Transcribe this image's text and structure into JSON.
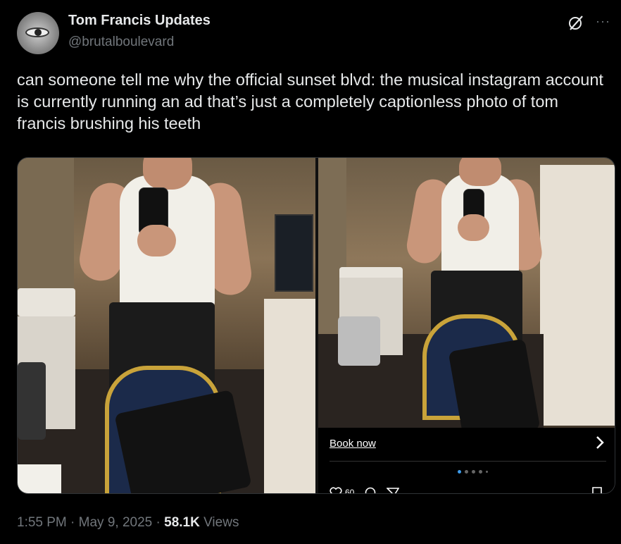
{
  "author": {
    "name": "Tom Francis Updates",
    "handle": "@brutalboulevard"
  },
  "tweet": {
    "text": "can someone tell me why the official sunset blvd: the musical instagram account is currently running an ad that’s just a completely captionless photo of tom francis brushing his teeth"
  },
  "ad": {
    "cta_label": "Book now",
    "like_count": "60"
  },
  "meta": {
    "time": "1:55 PM",
    "separator1": " · ",
    "date": "May 9, 2025",
    "separator2": " · ",
    "views_count": "58.1K",
    "views_label": " Views"
  },
  "icons": {
    "grok": "grok-icon",
    "more": "more-options-icon",
    "chevron": "chevron-right-icon",
    "heart": "heart-icon",
    "comment": "comment-icon",
    "send": "send-icon",
    "bookmark": "bookmark-icon"
  },
  "colors": {
    "background": "#000000",
    "text_primary": "#e7e9ea",
    "text_secondary": "#71767b",
    "carousel_active": "#3d9bea"
  }
}
